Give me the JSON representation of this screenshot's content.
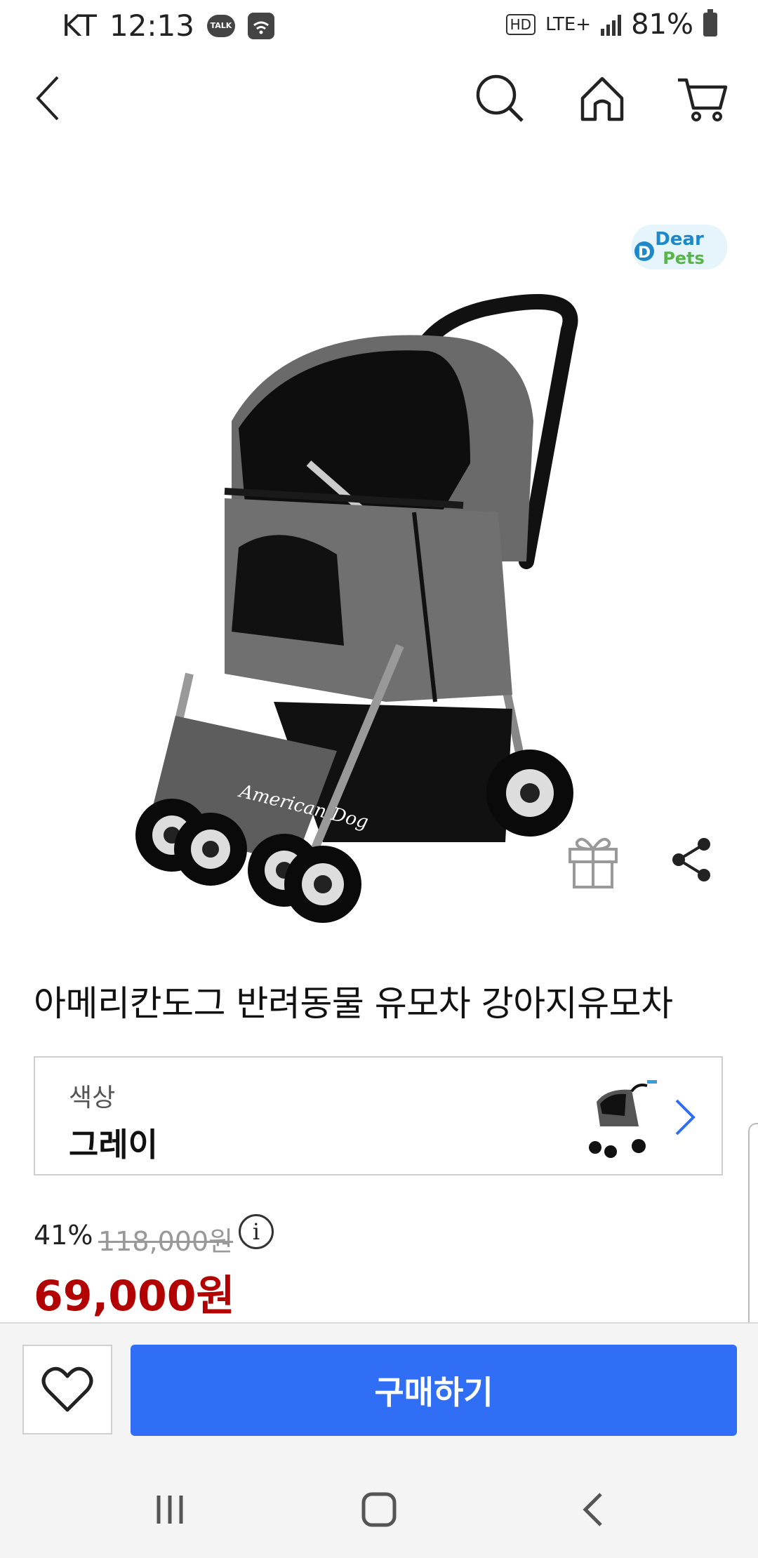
{
  "status_bar": {
    "carrier": "KT",
    "time": "12:13",
    "talk_label": "TALK",
    "hd_label": "HD",
    "network": "LTE+",
    "battery": "81%"
  },
  "nav": {
    "back_icon": "chevron-left-icon",
    "search_icon": "search-icon",
    "home_icon": "home-icon",
    "cart_icon": "cart-icon"
  },
  "product": {
    "brand_logo_text": "Dear Pets",
    "stroller_print": "American Dog",
    "title": "아메리칸도그 반려동물 유모차 강아지유모차",
    "option": {
      "label": "색상",
      "value": "그레이"
    },
    "pricing": {
      "discount_rate": "41%",
      "original_price": "118,000원",
      "info_icon_glyph": "i",
      "sale_price": "69,000원"
    }
  },
  "actions": {
    "buy_label": "구매하기",
    "wishlist_icon": "heart-icon",
    "gift_icon": "gift-icon",
    "share_icon": "share-icon"
  },
  "colors": {
    "accent": "#2f6ef5",
    "sale_price": "#b30000"
  }
}
